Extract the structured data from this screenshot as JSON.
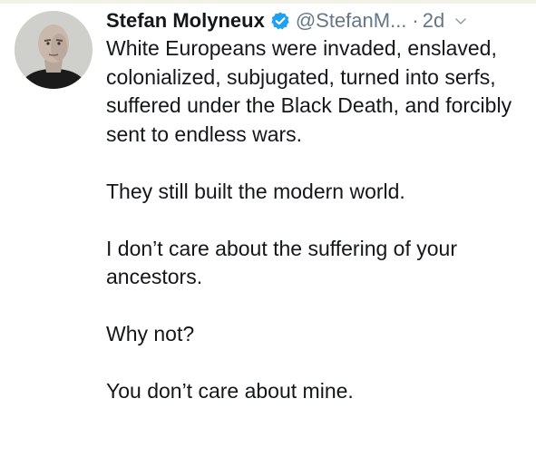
{
  "tweet": {
    "author": {
      "display_name": "Stefan Molyneux",
      "handle": "@StefanM...",
      "avatar_icon": "profile-photo"
    },
    "separator": "·",
    "timestamp": "2d",
    "verified_icon": "verified-badge-icon",
    "menu_icon": "chevron-down-icon",
    "paragraphs": [
      "White Europeans were invaded, enslaved, colonialized, subjugated, turned into serfs, suffered under the Black Death, and forcibly sent to endless wars.",
      "They still built the modern world.",
      "I don’t care about the suffering of your ancestors.",
      "Why not?",
      "You don’t care about mine."
    ]
  },
  "colors": {
    "verified_blue": "#1da1f2",
    "secondary_text": "#657786",
    "primary_text": "#14171a"
  }
}
